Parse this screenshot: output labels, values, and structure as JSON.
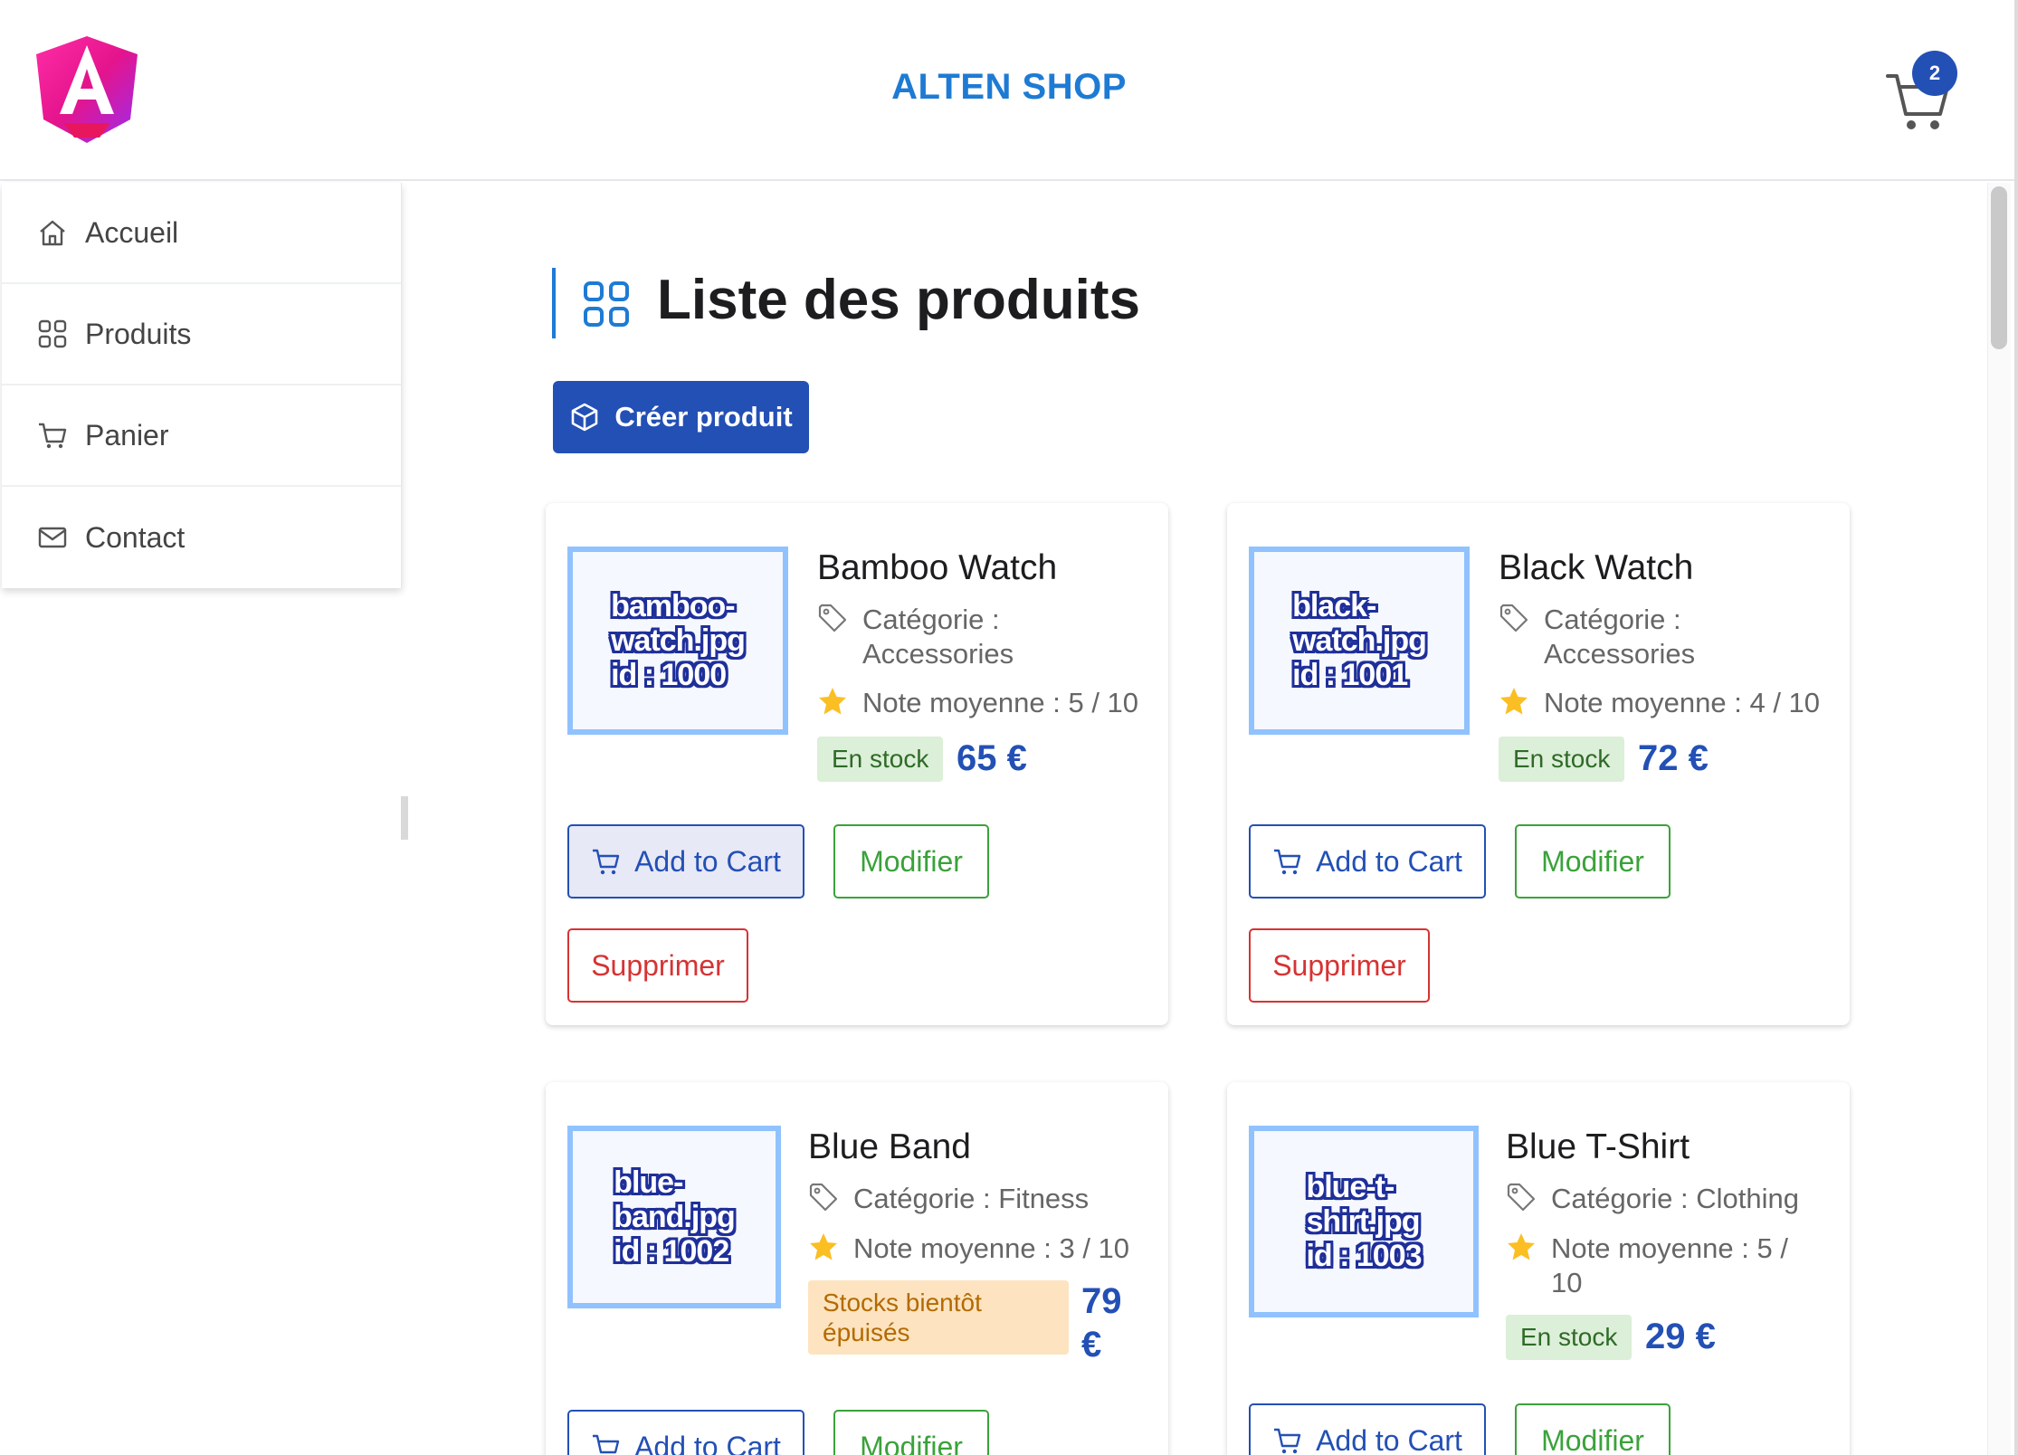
{
  "header": {
    "title": "ALTEN SHOP",
    "cart_count": "2"
  },
  "sidebar": {
    "items": [
      {
        "label": "Accueil",
        "icon": "home-icon"
      },
      {
        "label": "Produits",
        "icon": "grid-icon"
      },
      {
        "label": "Panier",
        "icon": "cart-icon"
      },
      {
        "label": "Contact",
        "icon": "envelope-icon"
      }
    ]
  },
  "main": {
    "title": "Liste des produits",
    "create_label": "Créer produit",
    "buttons": {
      "add_to_cart": "Add to Cart",
      "modify": "Modifier",
      "delete": "Supprimer"
    },
    "products": [
      {
        "name": "Bamboo Watch",
        "image_text": "bamboo-\nwatch.jpg\nid : 1000",
        "category": "Catégorie :\nAccessories",
        "rating": "Note moyenne : 5 / 10",
        "stock": "En stock",
        "price": "65 €"
      },
      {
        "name": "Black Watch",
        "image_text": "black-\nwatch.jpg\nid : 1001",
        "category": "Catégorie :\nAccessories",
        "rating": "Note moyenne : 4 / 10",
        "stock": "En stock",
        "price": "72 €"
      },
      {
        "name": "Blue Band",
        "image_text": "blue-\nband.jpg\nid : 1002",
        "category": "Catégorie : Fitness",
        "rating": "Note moyenne : 3 / 10",
        "stock": "Stocks bientôt\népuisés",
        "price": "79\n€"
      },
      {
        "name": "Blue T-Shirt",
        "image_text": "blue-t-\nshirt.jpg\nid : 1003",
        "category": "Catégorie : Clothing",
        "rating": "Note moyenne : 5 /\n10",
        "stock": "En stock",
        "price": "29 €"
      }
    ]
  },
  "colors": {
    "accent": "#2350b5",
    "title_blue": "#1e7bd4",
    "success": "#3aa23a",
    "danger": "#d63333",
    "warning_text": "#b36b00"
  }
}
